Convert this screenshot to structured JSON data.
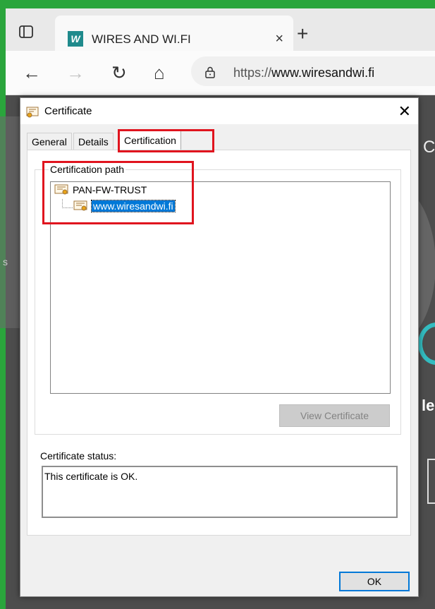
{
  "browser": {
    "tab": {
      "logo": "W",
      "title": "WIRES AND WI.FI",
      "close": "×"
    },
    "new_tab": "+",
    "nav": {
      "back": "←",
      "forward": "→",
      "refresh": "↻",
      "home": "⌂"
    },
    "url_prefix": "https://",
    "url_host": "www.wiresandwi.fi"
  },
  "page_fragments": {
    "top": "C",
    "middle": "le",
    "left": "s"
  },
  "dialog": {
    "title": "Certificate",
    "close": "✕",
    "tabs": [
      {
        "label": "General",
        "active": false
      },
      {
        "label": "Details",
        "active": false
      },
      {
        "label": "Certification Path",
        "active": true
      }
    ],
    "group_label": "Certification path",
    "tree": [
      {
        "label": "PAN-FW-TRUST",
        "level": 0,
        "selected": false
      },
      {
        "label": "www.wiresandwi.fi",
        "level": 1,
        "selected": true
      }
    ],
    "view_certificate": "View Certificate",
    "status_label": "Certificate status:",
    "status_text": "This certificate is OK.",
    "ok": "OK"
  },
  "colors": {
    "highlight": "#e0141e",
    "selection": "#0078d7",
    "frame": "#2aa53c"
  }
}
